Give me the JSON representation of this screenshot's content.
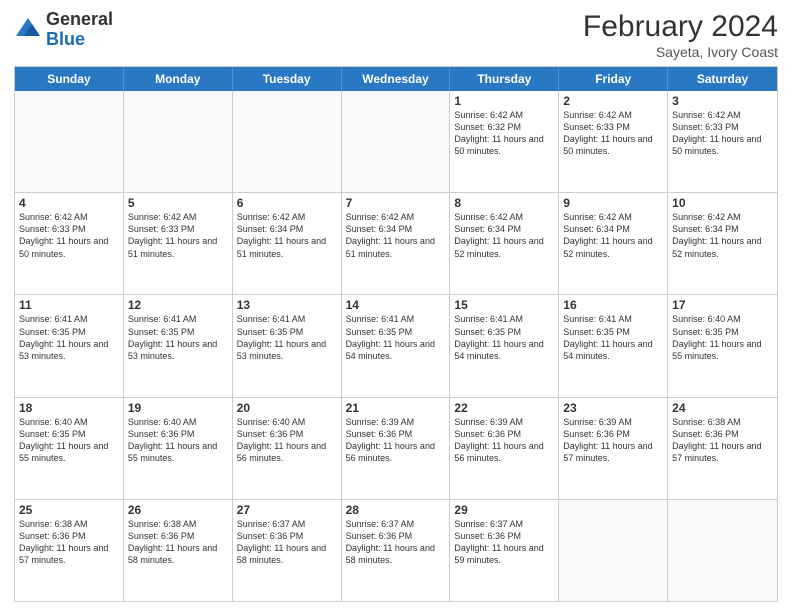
{
  "logo": {
    "general": "General",
    "blue": "Blue"
  },
  "header": {
    "month": "February 2024",
    "location": "Sayeta, Ivory Coast"
  },
  "days": [
    "Sunday",
    "Monday",
    "Tuesday",
    "Wednesday",
    "Thursday",
    "Friday",
    "Saturday"
  ],
  "rows": [
    [
      {
        "day": "",
        "info": ""
      },
      {
        "day": "",
        "info": ""
      },
      {
        "day": "",
        "info": ""
      },
      {
        "day": "",
        "info": ""
      },
      {
        "day": "1",
        "info": "Sunrise: 6:42 AM\nSunset: 6:32 PM\nDaylight: 11 hours and 50 minutes."
      },
      {
        "day": "2",
        "info": "Sunrise: 6:42 AM\nSunset: 6:33 PM\nDaylight: 11 hours and 50 minutes."
      },
      {
        "day": "3",
        "info": "Sunrise: 6:42 AM\nSunset: 6:33 PM\nDaylight: 11 hours and 50 minutes."
      }
    ],
    [
      {
        "day": "4",
        "info": "Sunrise: 6:42 AM\nSunset: 6:33 PM\nDaylight: 11 hours and 50 minutes."
      },
      {
        "day": "5",
        "info": "Sunrise: 6:42 AM\nSunset: 6:33 PM\nDaylight: 11 hours and 51 minutes."
      },
      {
        "day": "6",
        "info": "Sunrise: 6:42 AM\nSunset: 6:34 PM\nDaylight: 11 hours and 51 minutes."
      },
      {
        "day": "7",
        "info": "Sunrise: 6:42 AM\nSunset: 6:34 PM\nDaylight: 11 hours and 51 minutes."
      },
      {
        "day": "8",
        "info": "Sunrise: 6:42 AM\nSunset: 6:34 PM\nDaylight: 11 hours and 52 minutes."
      },
      {
        "day": "9",
        "info": "Sunrise: 6:42 AM\nSunset: 6:34 PM\nDaylight: 11 hours and 52 minutes."
      },
      {
        "day": "10",
        "info": "Sunrise: 6:42 AM\nSunset: 6:34 PM\nDaylight: 11 hours and 52 minutes."
      }
    ],
    [
      {
        "day": "11",
        "info": "Sunrise: 6:41 AM\nSunset: 6:35 PM\nDaylight: 11 hours and 53 minutes."
      },
      {
        "day": "12",
        "info": "Sunrise: 6:41 AM\nSunset: 6:35 PM\nDaylight: 11 hours and 53 minutes."
      },
      {
        "day": "13",
        "info": "Sunrise: 6:41 AM\nSunset: 6:35 PM\nDaylight: 11 hours and 53 minutes."
      },
      {
        "day": "14",
        "info": "Sunrise: 6:41 AM\nSunset: 6:35 PM\nDaylight: 11 hours and 54 minutes."
      },
      {
        "day": "15",
        "info": "Sunrise: 6:41 AM\nSunset: 6:35 PM\nDaylight: 11 hours and 54 minutes."
      },
      {
        "day": "16",
        "info": "Sunrise: 6:41 AM\nSunset: 6:35 PM\nDaylight: 11 hours and 54 minutes."
      },
      {
        "day": "17",
        "info": "Sunrise: 6:40 AM\nSunset: 6:35 PM\nDaylight: 11 hours and 55 minutes."
      }
    ],
    [
      {
        "day": "18",
        "info": "Sunrise: 6:40 AM\nSunset: 6:35 PM\nDaylight: 11 hours and 55 minutes."
      },
      {
        "day": "19",
        "info": "Sunrise: 6:40 AM\nSunset: 6:36 PM\nDaylight: 11 hours and 55 minutes."
      },
      {
        "day": "20",
        "info": "Sunrise: 6:40 AM\nSunset: 6:36 PM\nDaylight: 11 hours and 56 minutes."
      },
      {
        "day": "21",
        "info": "Sunrise: 6:39 AM\nSunset: 6:36 PM\nDaylight: 11 hours and 56 minutes."
      },
      {
        "day": "22",
        "info": "Sunrise: 6:39 AM\nSunset: 6:36 PM\nDaylight: 11 hours and 56 minutes."
      },
      {
        "day": "23",
        "info": "Sunrise: 6:39 AM\nSunset: 6:36 PM\nDaylight: 11 hours and 57 minutes."
      },
      {
        "day": "24",
        "info": "Sunrise: 6:38 AM\nSunset: 6:36 PM\nDaylight: 11 hours and 57 minutes."
      }
    ],
    [
      {
        "day": "25",
        "info": "Sunrise: 6:38 AM\nSunset: 6:36 PM\nDaylight: 11 hours and 57 minutes."
      },
      {
        "day": "26",
        "info": "Sunrise: 6:38 AM\nSunset: 6:36 PM\nDaylight: 11 hours and 58 minutes."
      },
      {
        "day": "27",
        "info": "Sunrise: 6:37 AM\nSunset: 6:36 PM\nDaylight: 11 hours and 58 minutes."
      },
      {
        "day": "28",
        "info": "Sunrise: 6:37 AM\nSunset: 6:36 PM\nDaylight: 11 hours and 58 minutes."
      },
      {
        "day": "29",
        "info": "Sunrise: 6:37 AM\nSunset: 6:36 PM\nDaylight: 11 hours and 59 minutes."
      },
      {
        "day": "",
        "info": ""
      },
      {
        "day": "",
        "info": ""
      }
    ]
  ]
}
